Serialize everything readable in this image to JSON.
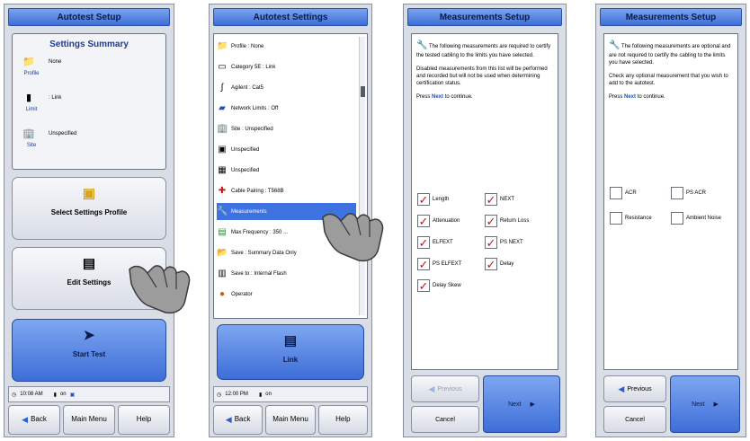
{
  "screen1": {
    "title": "Autotest Setup",
    "summary_title": "Settings Summary",
    "rows": [
      {
        "caption": "Profile",
        "value": "None",
        "icon": "profile-folder-icon",
        "glyph": "📁"
      },
      {
        "caption": "Limit",
        "value": ": Link",
        "icon": "limit-icon",
        "glyph": "▮"
      },
      {
        "caption": "Site",
        "value": "Unspecified",
        "icon": "site-building-icon",
        "glyph": "🏢"
      }
    ],
    "buttons": {
      "select_profile": "Select Settings Profile",
      "edit_settings": "Edit Settings",
      "start_test": "Start Test"
    },
    "status": {
      "time": "10:08 AM",
      "battery": "on"
    },
    "bottom": {
      "back": "Back",
      "main_menu": "Main Menu",
      "help": "Help"
    }
  },
  "screen2": {
    "title": "Autotest Settings",
    "items": [
      {
        "label": "Profile : None",
        "icon": "profile-folder-icon",
        "glyph": "📁"
      },
      {
        "label": "Category 5E : Link",
        "icon": "category-cable-icon",
        "glyph": "▭"
      },
      {
        "label": "Agilent : Cat5",
        "icon": "plug-icon",
        "glyph": "ʃ"
      },
      {
        "label": "Network Limits : Off",
        "icon": "network-icon",
        "glyph": "▰"
      },
      {
        "label": "Site : Unspecified",
        "icon": "site-building-icon",
        "glyph": "🏢"
      },
      {
        "label": "Unspecified",
        "icon": "operator-icon",
        "glyph": "▣"
      },
      {
        "label": "Unspecified",
        "icon": "record-icon",
        "glyph": "▦"
      },
      {
        "label": "Cable Pairing : T568B",
        "icon": "cable-pairing-icon",
        "glyph": "✚"
      },
      {
        "label": "Measurements",
        "icon": "wrench-icon",
        "glyph": "🔧",
        "selected": true
      },
      {
        "label": "Max Frequency : 350 ...",
        "icon": "frequency-icon",
        "glyph": "▤"
      },
      {
        "label": "Save : Summary Data Only",
        "icon": "save-folder-icon",
        "glyph": "📂"
      },
      {
        "label": "Save to : Internal Flash",
        "icon": "flash-icon",
        "glyph": "▥"
      },
      {
        "label": "Operator",
        "icon": "operator-person-icon",
        "glyph": "●"
      }
    ],
    "button": "Link",
    "status": {
      "time": "12:00 PM",
      "battery": "on"
    },
    "bottom": {
      "back": "Back",
      "main_menu": "Main Menu",
      "help": "Help"
    }
  },
  "screen3": {
    "title": "Measurements Setup",
    "para1": "The following measurements are required to certify the tested cabling to the limits you have selected.",
    "para2": "Disabled measurements from this list will be performed and recorded but will not be used when determining certification status.",
    "para3_pre": "Press ",
    "para3_link": "Next",
    "para3_post": " to continue.",
    "checks": [
      {
        "label": "Length",
        "checked": true
      },
      {
        "label": "NEXT",
        "checked": true
      },
      {
        "label": "Attenuation",
        "checked": true
      },
      {
        "label": "Return Loss",
        "checked": true
      },
      {
        "label": "ELFEXT",
        "checked": true
      },
      {
        "label": "PS NEXT",
        "checked": true
      },
      {
        "label": "PS ELFEXT",
        "checked": true
      },
      {
        "label": "Delay",
        "checked": true
      },
      {
        "label": "Delay Skew",
        "checked": true
      }
    ],
    "previous": "Previous",
    "cancel": "Cancel",
    "next": "Next"
  },
  "screen4": {
    "title": "Measurements Setup",
    "para1": "The following measurements are optional and are not required to certify the cabling to the limits you have selected.",
    "para2": "Check any optional measurement that you wish to add to the autotest.",
    "para3_pre": "Press ",
    "para3_link": "Next",
    "para3_post": " to continue.",
    "checks": [
      {
        "label": "ACR",
        "checked": false
      },
      {
        "label": "PS ACR",
        "checked": false
      },
      {
        "label": "Resistance",
        "checked": false
      },
      {
        "label": "Ambient Noise",
        "checked": false
      }
    ],
    "previous": "Previous",
    "cancel": "Cancel",
    "next": "Next"
  },
  "colors": {
    "accent": "#3d72e0",
    "check": "#c01818"
  }
}
